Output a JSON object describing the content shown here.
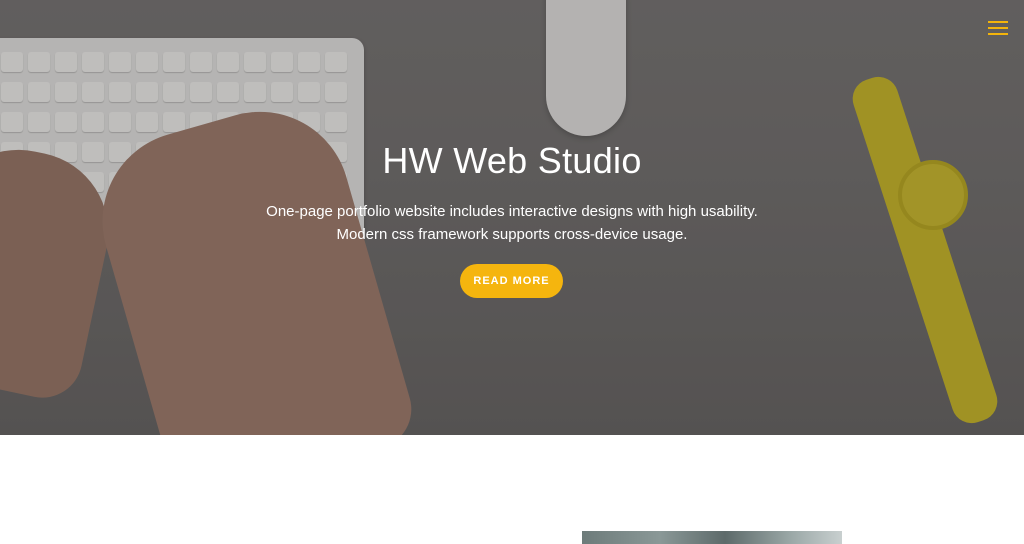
{
  "hero": {
    "title": "HW Web Studio",
    "line1": "One-page portfolio website includes interactive designs with high usability.",
    "line2": "Modern css framework supports cross-device usage.",
    "button_label": "READ MORE"
  },
  "nav": {
    "menu_icon": "hamburger-menu-icon"
  },
  "colors": {
    "accent": "#f5b50e",
    "hero_text": "#ffffff",
    "page_background": "#ffffff"
  }
}
